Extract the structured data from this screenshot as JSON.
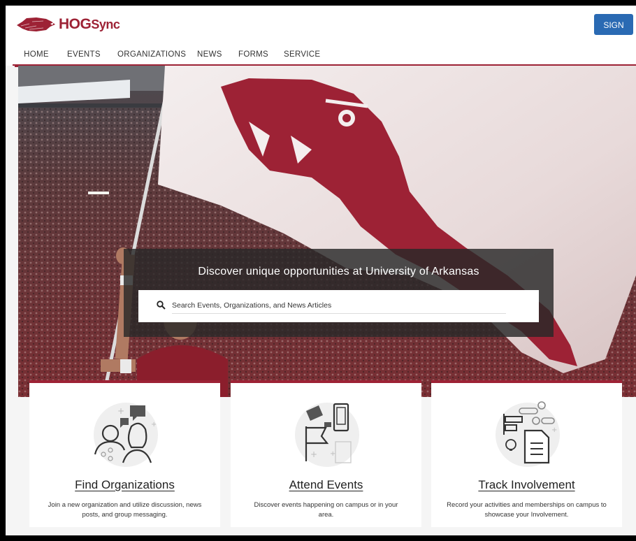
{
  "header": {
    "logo_text_bold": "HOG",
    "logo_text_rest": "Sync",
    "signin_label": "SIGN IN"
  },
  "nav": {
    "items": [
      {
        "label": "HOME",
        "active": true
      },
      {
        "label": "EVENTS"
      },
      {
        "label": "ORGANIZATIONS"
      },
      {
        "label": "NEWS"
      },
      {
        "label": "FORMS"
      },
      {
        "label": "SERVICE"
      }
    ]
  },
  "hero": {
    "heading": "Discover unique opportunities at University of Arkansas",
    "search_placeholder": "Search Events, Organizations, and News Articles"
  },
  "cards": [
    {
      "title": "Find Organizations",
      "description": "Join a new organization and utilize discussion, news posts, and group messaging.",
      "icon": "people-chat-icon"
    },
    {
      "title": "Attend Events",
      "description": "Discover events happening on campus or in your area.",
      "icon": "events-ticket-phone-icon"
    },
    {
      "title": "Track Involvement",
      "description": "Record your activities and memberships on campus to showcase your Involvement.",
      "icon": "involvement-document-icon"
    }
  ],
  "colors": {
    "brand": "#9d2235",
    "button": "#2a6ab3"
  }
}
